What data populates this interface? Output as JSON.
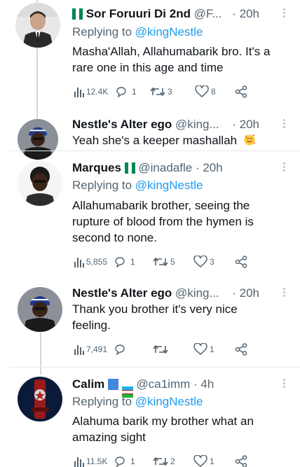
{
  "tweets": [
    {
      "name": "Sor Foruuri Di 2nd",
      "handle": "@F...",
      "time": "· 20h",
      "reply_prefix": "Replying to",
      "reply_to": "@kingNestle",
      "text": "Masha'Allah, Allahumabarik bro. It's a rare one in this age and time",
      "views": "12.4K",
      "replies": "1",
      "retweets": "3",
      "likes": "8",
      "flag": "nigeria-flag"
    },
    {
      "name": "Nestle's Alter ego",
      "handle": "@king...",
      "time": "· 20h",
      "text": "Yeah she's a keeper mashallah",
      "emoji": "smiling-face-with-hearts"
    },
    {
      "name": "Marques",
      "handle": "@inadafle",
      "time": "· 20h",
      "reply_prefix": "Replying to",
      "reply_to": "@kingNestle",
      "text": "Allahumabarik brother, seeing the rupture of blood from the hymen is second to none.",
      "views": "5,855",
      "replies": "1",
      "retweets": "5",
      "likes": "3",
      "flag": "nigeria-flag"
    },
    {
      "name": "Nestle's Alter ego",
      "handle": "@king...",
      "time": "· 20h",
      "text": "Thank you brother it's very nice feeling.",
      "views": "7,491",
      "replies": "",
      "retweets": "",
      "likes": "1"
    },
    {
      "name": "Calim",
      "handle": "@ca1imm",
      "time": "· 4h",
      "reply_prefix": "Replying to",
      "reply_to": "@kingNestle",
      "text": "Alahuma barik my brother what an amazing sight",
      "views": "11.5K",
      "replies": "1",
      "retweets": "2",
      "likes": "1",
      "flags": [
        "somalia-flag",
        "uzbekistan-flag"
      ]
    }
  ],
  "colors": {
    "accent": "#1d9bf0",
    "secondary_text": "#536471",
    "divider": "#e6ecf0"
  }
}
